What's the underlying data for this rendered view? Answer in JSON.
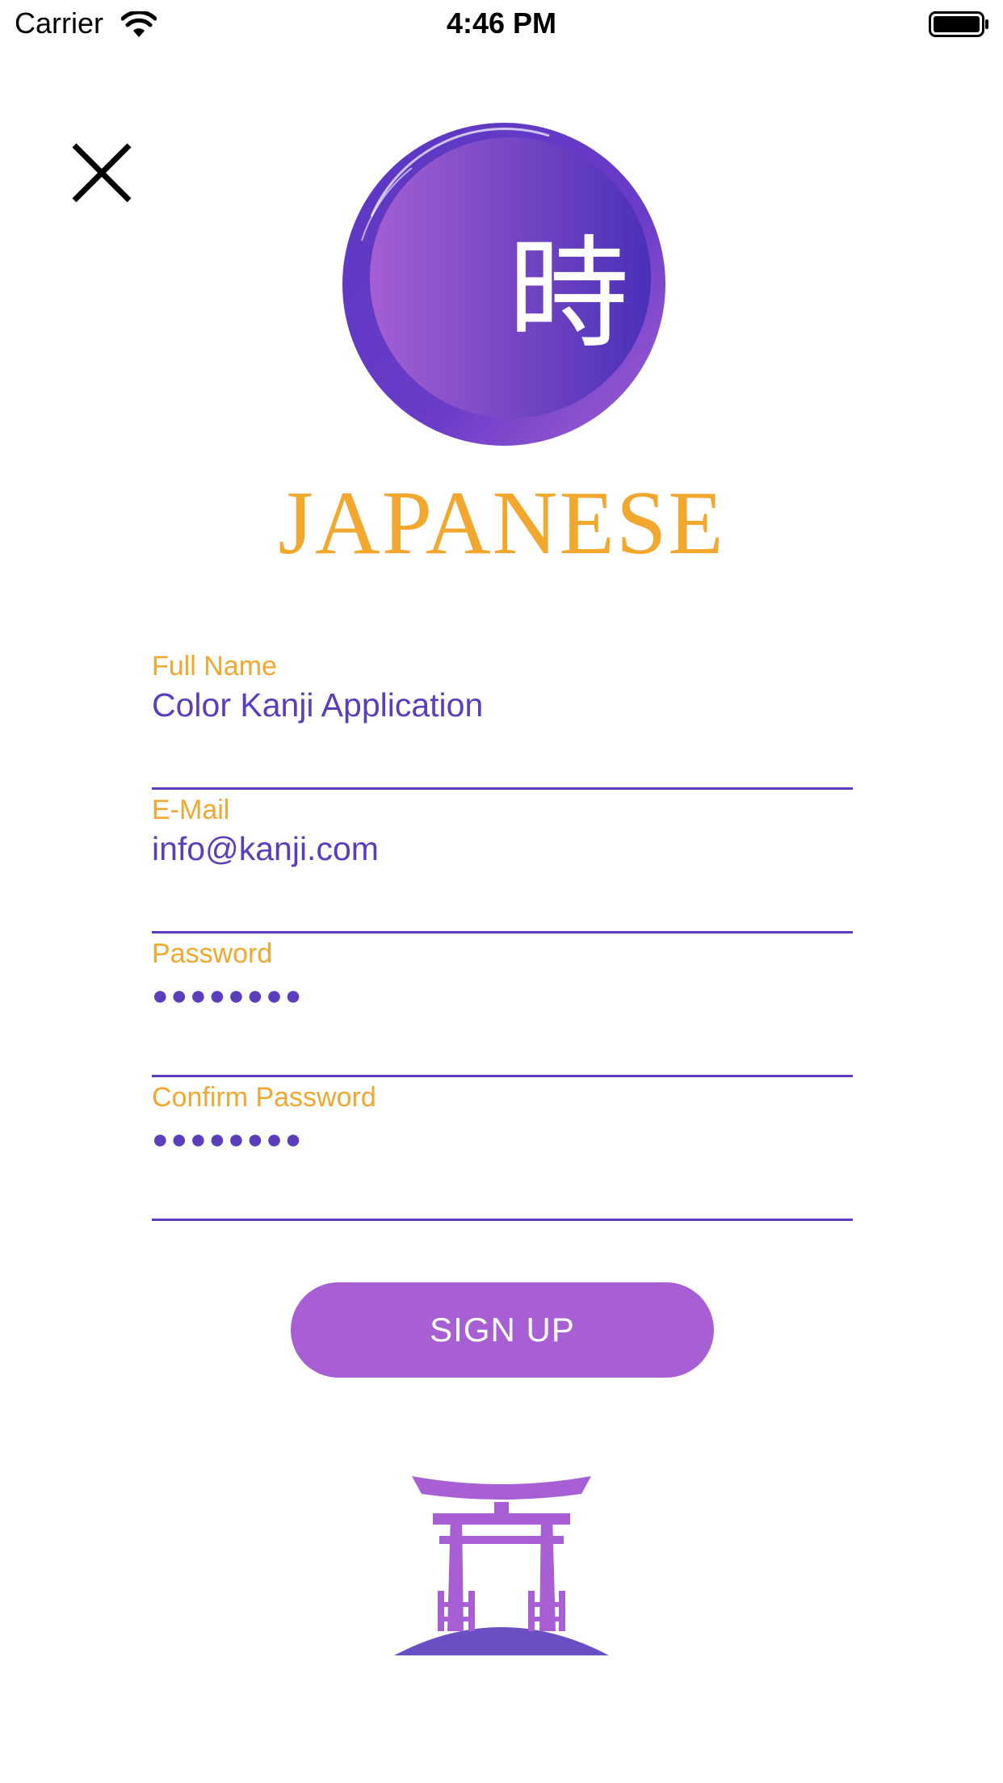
{
  "status_bar": {
    "carrier": "Carrier",
    "time": "4:46 PM",
    "wifi_icon": "wifi-icon",
    "battery_icon": "battery-full-icon"
  },
  "close_icon": "close-icon",
  "logo": {
    "kanji": "時",
    "brand": "JAPANESE"
  },
  "form": {
    "full_name": {
      "label": "Full Name",
      "value": "Color Kanji Application"
    },
    "email": {
      "label": "E-Mail",
      "value": "info@kanji.com"
    },
    "password": {
      "label": "Password",
      "value": "●●●●●●●●"
    },
    "confirm_password": {
      "label": "Confirm Password",
      "value": "●●●●●●●●"
    }
  },
  "signup_button": {
    "label": "SIGN UP"
  },
  "footer_icon": "torii-gate-icon",
  "colors": {
    "accent_orange": "#f2a72e",
    "accent_purple": "#5b3dbd",
    "button_purple": "#a85fd4"
  }
}
